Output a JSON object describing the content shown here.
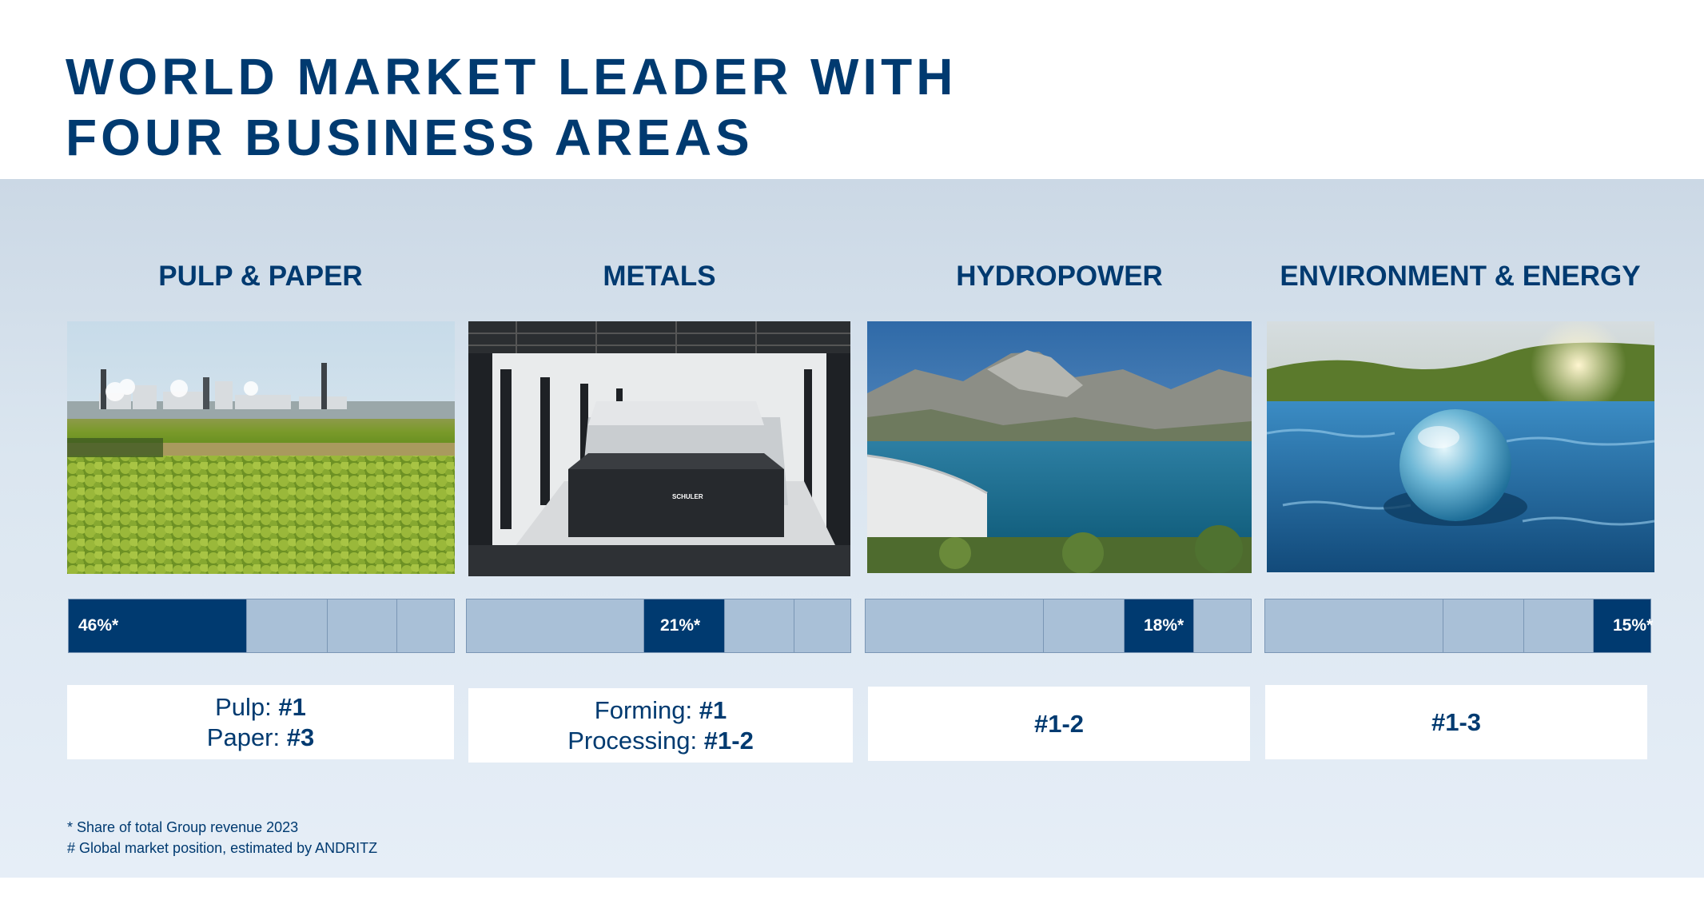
{
  "title": {
    "line1": "WORLD MARKET LEADER WITH",
    "line2": "FOUR BUSINESS AREAS"
  },
  "areas": [
    {
      "name": "PULP & PAPER",
      "share": "46%*",
      "share_value": 46,
      "highlight_segment": 1,
      "positions": [
        {
          "label": "Pulp: ",
          "rank": "#1"
        },
        {
          "label": "Paper: ",
          "rank": "#3"
        }
      ],
      "photo": "pulp-mill-plantation-photo"
    },
    {
      "name": "METALS",
      "share": "21%*",
      "share_value": 21,
      "highlight_segment": 2,
      "positions": [
        {
          "label": "Forming: ",
          "rank": "#1"
        },
        {
          "label": "Processing: ",
          "rank": "#1-2"
        }
      ],
      "photo": "press-factory-hall-photo",
      "photo_sign": "SCHULER"
    },
    {
      "name": "HYDROPOWER",
      "share": "18%*",
      "share_value": 18,
      "highlight_segment": 3,
      "positions": [
        {
          "label": "",
          "rank": "#1-2"
        }
      ],
      "photo": "mountain-dam-lake-photo"
    },
    {
      "name": "ENVIRONMENT & ENERGY",
      "share": "15%*",
      "share_value": 15,
      "highlight_segment": 4,
      "positions": [
        {
          "label": "",
          "rank": "#1-3"
        }
      ],
      "photo": "glass-sphere-water-photo"
    }
  ],
  "footnotes": {
    "share": "* Share of total Group revenue 2023",
    "position": "# Global market position, estimated by ANDRITZ"
  },
  "colors": {
    "brand_blue": "#003a70",
    "bar_inactive": "#a9c0d7",
    "panel_top": "#cbd8e5",
    "panel_bottom": "#e6eef7"
  }
}
